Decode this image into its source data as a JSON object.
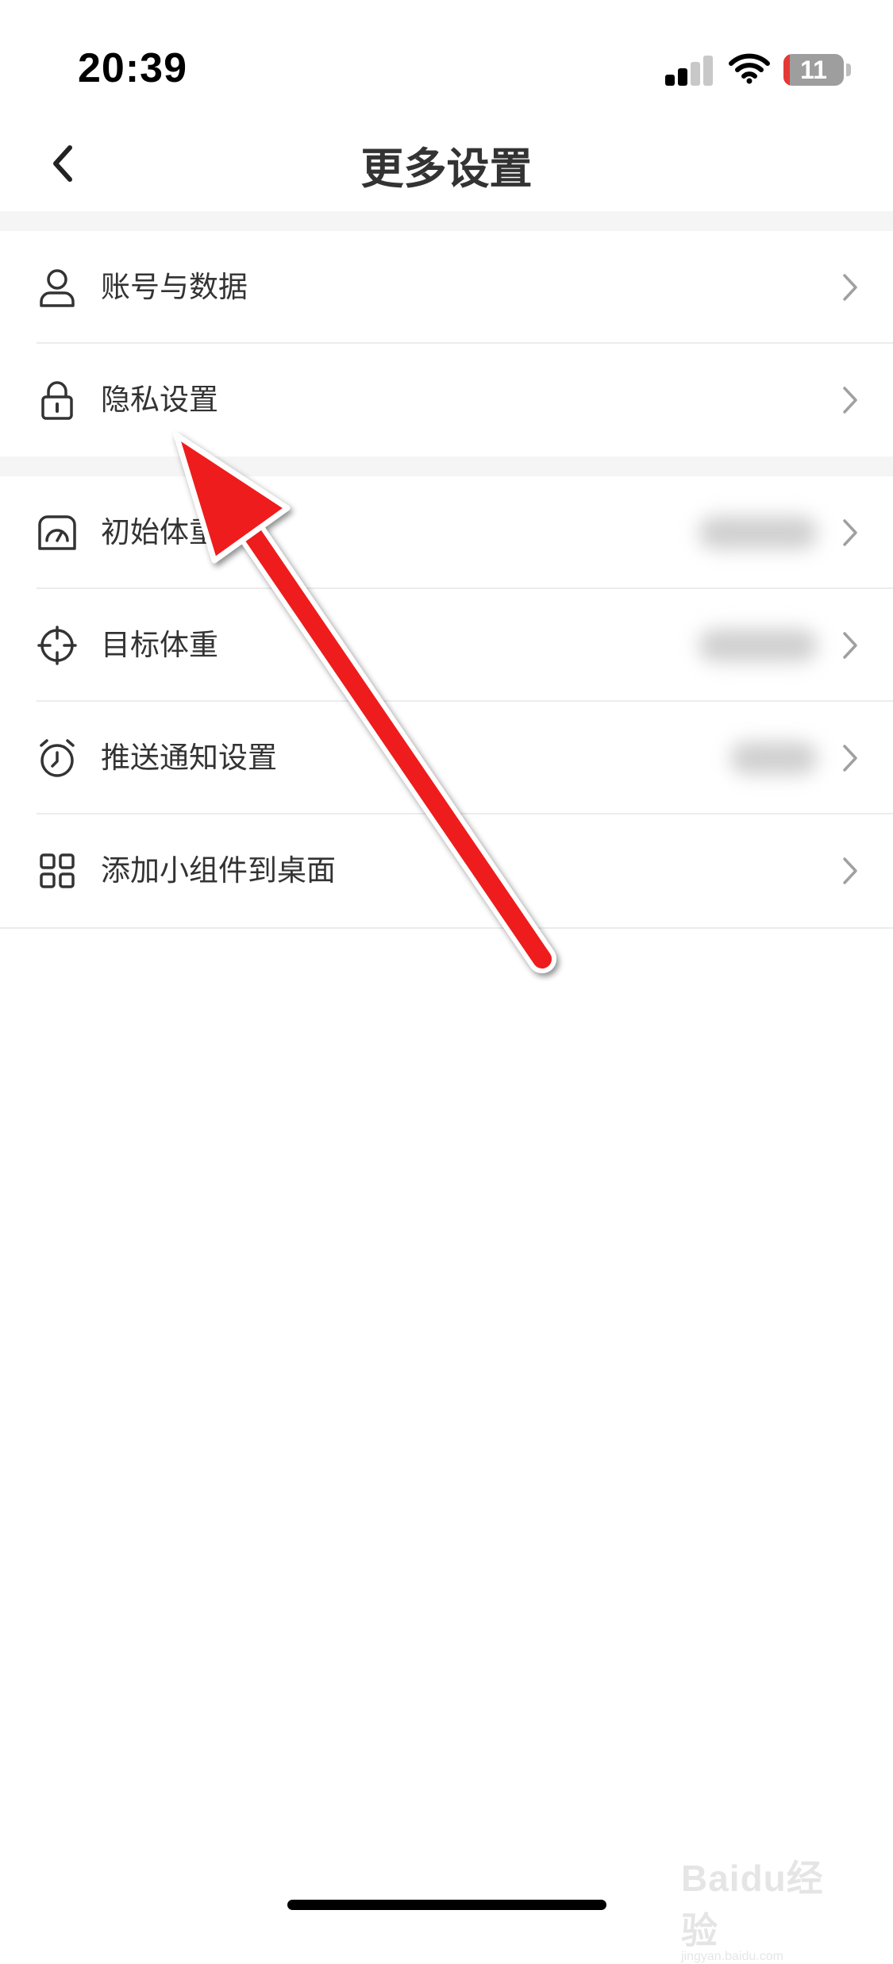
{
  "status_bar": {
    "time": "20:39",
    "battery_level": "11",
    "battery_color": "#e53935",
    "signal_bars_active": 2,
    "icons": [
      "signal-icon",
      "wifi-icon",
      "battery-icon"
    ]
  },
  "header": {
    "title": "更多设置",
    "back_icon": "back-chevron-icon"
  },
  "groups": [
    {
      "items": [
        {
          "label": "账号与数据",
          "icon": "user-icon"
        },
        {
          "label": "隐私设置",
          "icon": "lock-icon"
        }
      ]
    },
    {
      "items": [
        {
          "label": "初始体重",
          "icon": "scale-icon",
          "value_blurred": true
        },
        {
          "label": "目标体重",
          "icon": "target-icon",
          "value_blurred": true
        },
        {
          "label": "推送通知设置",
          "icon": "alarm-clock-icon",
          "value_blurred": true
        },
        {
          "label": "添加小组件到桌面",
          "icon": "widgets-grid-icon"
        }
      ]
    }
  ],
  "overlay": {
    "annotation_arrow_color": "#ee1c1c",
    "watermark_text": "Baidu经验",
    "watermark_subtext": "jingyan.baidu.com"
  },
  "colors": {
    "background": "#ffffff",
    "separator": "#f5f5f5",
    "text": "#333333",
    "chevron": "#a0a0a0"
  }
}
